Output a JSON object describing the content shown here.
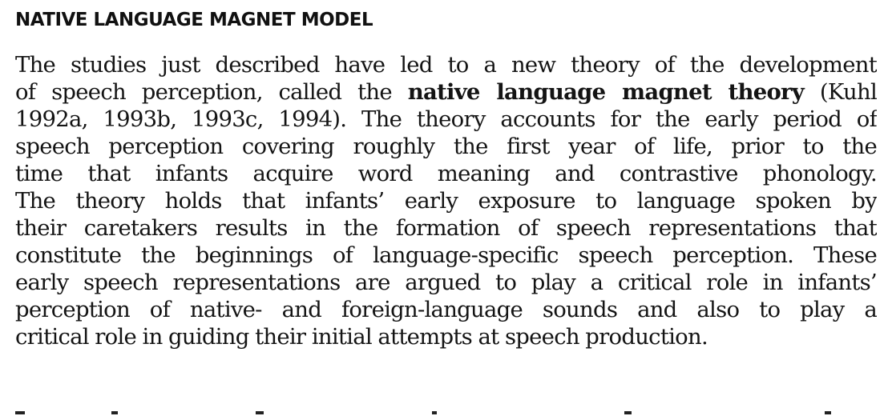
{
  "heading": "NATIVE LANGUAGE MAGNET MODEL",
  "paragraph": {
    "l1": "The studies just described have led to a new theory of the development",
    "l2_pre": "of speech perception, called the ",
    "l2_bold": "native language magnet theory",
    "l2_post": " (Kuhl",
    "l3": "1992a, 1993b, 1993c, 1994). The theory accounts for the early period of",
    "l4": "speech perception covering roughly the first year of life, prior to the",
    "l5": "time that infants acquire word meaning and contrastive phonology.",
    "l6": "The theory holds that infants’ early exposure to language spoken by",
    "l7": "their caretakers results in the formation of speech representations that",
    "l8": "constitute the beginnings of language-specific speech perception. These",
    "l9": "early speech representations are argued to play a critical role in infants’",
    "l10": "perception of native- and foreign-language sounds and also to play a",
    "l11": "critical role in guiding their initial attempts at speech production."
  }
}
